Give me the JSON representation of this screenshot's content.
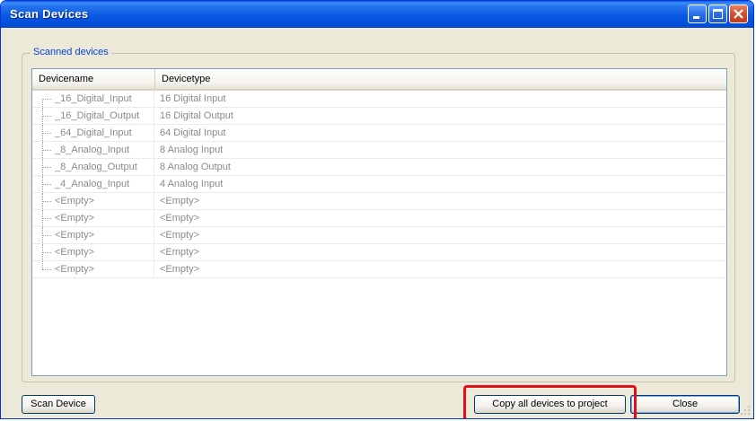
{
  "window": {
    "title": "Scan Devices"
  },
  "titlebar_buttons": {
    "minimize": "minimize-icon",
    "maximize": "maximize-icon",
    "close": "close-icon"
  },
  "group": {
    "legend": "Scanned devices"
  },
  "list": {
    "columns": [
      "Devicename",
      "Devicetype"
    ],
    "rows": [
      {
        "name": "_16_Digital_Input",
        "type": "16 Digital Input"
      },
      {
        "name": "_16_Digital_Output",
        "type": "16 Digital Output"
      },
      {
        "name": "_64_Digital_Input",
        "type": "64 Digital Input"
      },
      {
        "name": "_8_Analog_Input",
        "type": "8 Analog Input"
      },
      {
        "name": "_8_Analog_Output",
        "type": "8 Analog Output"
      },
      {
        "name": "_4_Analog_Input",
        "type": "4 Analog Input"
      },
      {
        "name": "<Empty>",
        "type": "<Empty>"
      },
      {
        "name": "<Empty>",
        "type": "<Empty>"
      },
      {
        "name": "<Empty>",
        "type": "<Empty>"
      },
      {
        "name": "<Empty>",
        "type": "<Empty>"
      },
      {
        "name": "<Empty>",
        "type": "<Empty>"
      }
    ]
  },
  "buttons": {
    "scan": "Scan Device",
    "copy": "Copy all devices to project",
    "close": "Close"
  },
  "colors": {
    "titlebar": "#0a58e0",
    "legend_text": "#0046d5",
    "highlight": "#e2101b",
    "window_bg": "#ece9d8"
  }
}
